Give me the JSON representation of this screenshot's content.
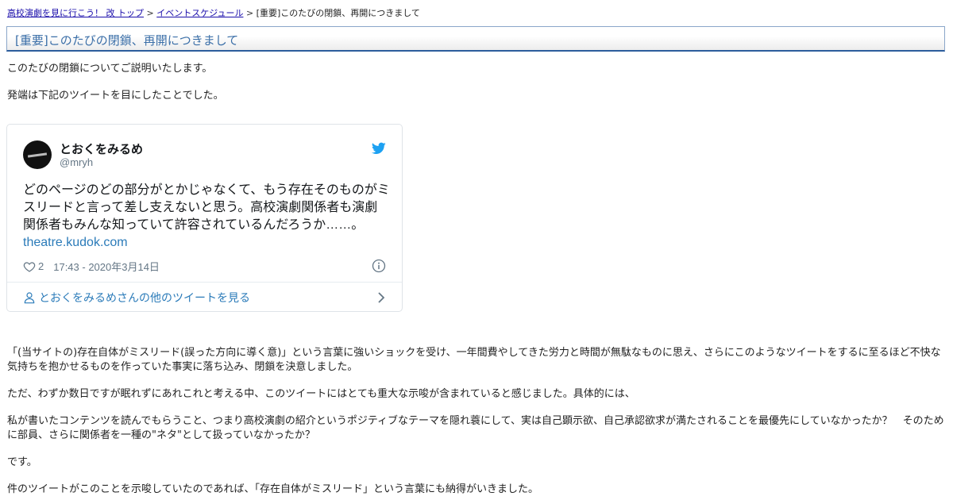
{
  "breadcrumb": {
    "home": "高校演劇を見に行こう！ 改 トップ",
    "schedule": "イベントスケジュール",
    "current": "[重要]このたびの閉鎖、再開につきまして",
    "separator": ">"
  },
  "page_title": "[重要]このたびの閉鎖、再開につきまして",
  "intro": [
    "このたびの閉鎖についてご説明いたします。",
    "発端は下記のツイートを目にしたことでした。"
  ],
  "tweet": {
    "name": "とおくをみるめ",
    "handle": "@mryh",
    "text": "どのページのどの部分がとかじゃなくて、もう存在そのものがミスリードと言って差し支えないと思う。高校演劇関係者も演劇関係者もみんな知っていて許容されているんだろうか……。",
    "link": "theatre.kudok.com",
    "likes": "2",
    "timestamp": "17:43 - 2020年3月14日",
    "more_label": "とおくをみるめさんの他のツイートを見る",
    "icons": {
      "bird": "twitter-bird-icon",
      "heart": "heart-icon",
      "info": "info-icon",
      "person": "person-icon",
      "chevron": "chevron-right-icon"
    },
    "accent_color": "#1da1f2"
  },
  "body": [
    "「(当サイトの)存在自体がミスリード(誤った方向に導く意)」という言葉に強いショックを受け、一年間費やしてきた労力と時間が無駄なものに思え、さらにこのようなツイートをするに至るほど不快な気持ちを抱かせるものを作っていた事実に落ち込み、閉鎖を決意しました。",
    "ただ、わずか数日ですが眠れずにあれこれと考える中、このツイートにはとても重大な示唆が含まれていると感じました。具体的には、",
    "私が書いたコンテンツを読んでもらうこと、つまり高校演劇の紹介というポジティブなテーマを隠れ蓑にして、実は自己顕示欲、自己承認欲求が満たされることを最優先にしていなかったか？　そのために部員、さらに関係者を一種の\"ネタ\"として扱っていなかったか？",
    "です。",
    "件のツイートがこのことを示唆していたのであれば、「存在自体がミスリード」という言葉にも納得がいきました。"
  ]
}
